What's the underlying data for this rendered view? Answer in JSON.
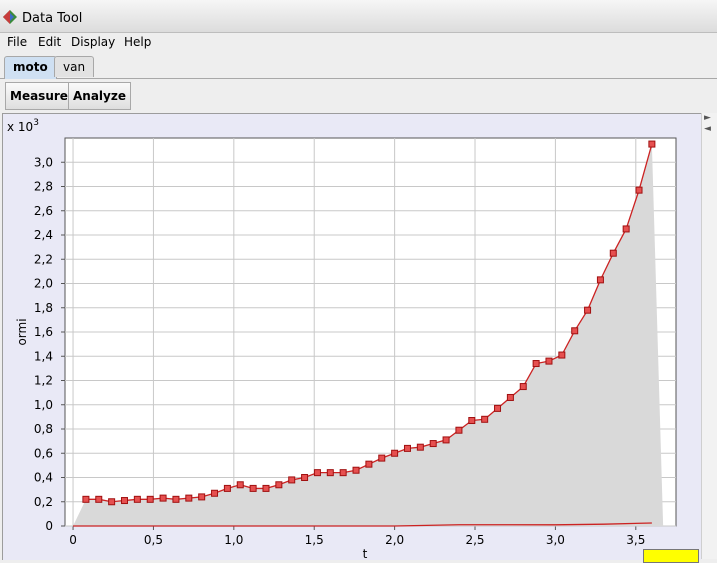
{
  "window": {
    "title": "Data Tool"
  },
  "menu": [
    "File",
    "Edit",
    "Display",
    "Help"
  ],
  "tabs": [
    {
      "label": "moto",
      "active": true
    },
    {
      "label": "van",
      "active": false
    }
  ],
  "toolbar": {
    "measure_label": "Measure",
    "analyze_label": "Analyze"
  },
  "icons": {
    "app": "data-tool-icon",
    "side_arrow_right": "arrow-right-icon",
    "side_arrow_left": "arrow-left-icon",
    "corner": "dropdown-icon"
  },
  "colors": {
    "series": "#cc2222",
    "marker_fill": "#e65050",
    "area": "#d9d9d9",
    "plot_bg": "#ffffff",
    "panel_bg": "#e9e9f6"
  },
  "chart_data": {
    "type": "line",
    "title": "",
    "xlabel": "t",
    "ylabel": "ormi",
    "y_multiplier": "x 10",
    "y_multiplier_exp": "3",
    "xlim": [
      -0.05,
      3.75
    ],
    "ylim": [
      0,
      3.2
    ],
    "grid": true,
    "x_ticks": [
      0,
      0.5,
      1.0,
      1.5,
      2.0,
      2.5,
      3.0,
      3.5
    ],
    "x_tick_labels": [
      "0",
      "0,5",
      "1,0",
      "1,5",
      "2,0",
      "2,5",
      "3,0",
      "3,5"
    ],
    "y_ticks": [
      0,
      0.2,
      0.4,
      0.6,
      0.8,
      1.0,
      1.2,
      1.4,
      1.6,
      1.8,
      2.0,
      2.2,
      2.4,
      2.6,
      2.8,
      3.0
    ],
    "y_tick_labels": [
      "0",
      "0,2",
      "0,4",
      "0,6",
      "0,8",
      "1,0",
      "1,2",
      "1,4",
      "1,6",
      "1,8",
      "2,0",
      "2,2",
      "2,4",
      "2,6",
      "2,8",
      "3,0"
    ],
    "series": [
      {
        "x": [
          0.08,
          0.16,
          0.24,
          0.32,
          0.4,
          0.48,
          0.56,
          0.64,
          0.72,
          0.8,
          0.88,
          0.96,
          1.04,
          1.12,
          1.2,
          1.28,
          1.36,
          1.44,
          1.52,
          1.6,
          1.68,
          1.76,
          1.84,
          1.92,
          2.0,
          2.08,
          2.16,
          2.24,
          2.32,
          2.4,
          2.48,
          2.56,
          2.64,
          2.72,
          2.8,
          2.88,
          2.96,
          3.04,
          3.12,
          3.2,
          3.28,
          3.36,
          3.44,
          3.52,
          3.6
        ],
        "y": [
          0.22,
          0.22,
          0.2,
          0.21,
          0.22,
          0.22,
          0.23,
          0.22,
          0.23,
          0.24,
          0.27,
          0.31,
          0.34,
          0.31,
          0.31,
          0.34,
          0.38,
          0.4,
          0.44,
          0.44,
          0.44,
          0.46,
          0.51,
          0.56,
          0.6,
          0.64,
          0.65,
          0.68,
          0.71,
          0.79,
          0.87,
          0.88,
          0.97,
          1.06,
          1.15,
          1.34,
          1.36,
          1.41,
          1.61,
          1.78,
          2.03,
          2.25,
          2.45,
          2.77,
          3.15
        ]
      },
      {
        "x": [
          0.0,
          1.0,
          2.0,
          2.4,
          3.0,
          3.3,
          3.6
        ],
        "y": [
          0.0,
          0.0,
          0.0,
          0.01,
          0.01,
          0.015,
          0.025
        ]
      }
    ]
  }
}
